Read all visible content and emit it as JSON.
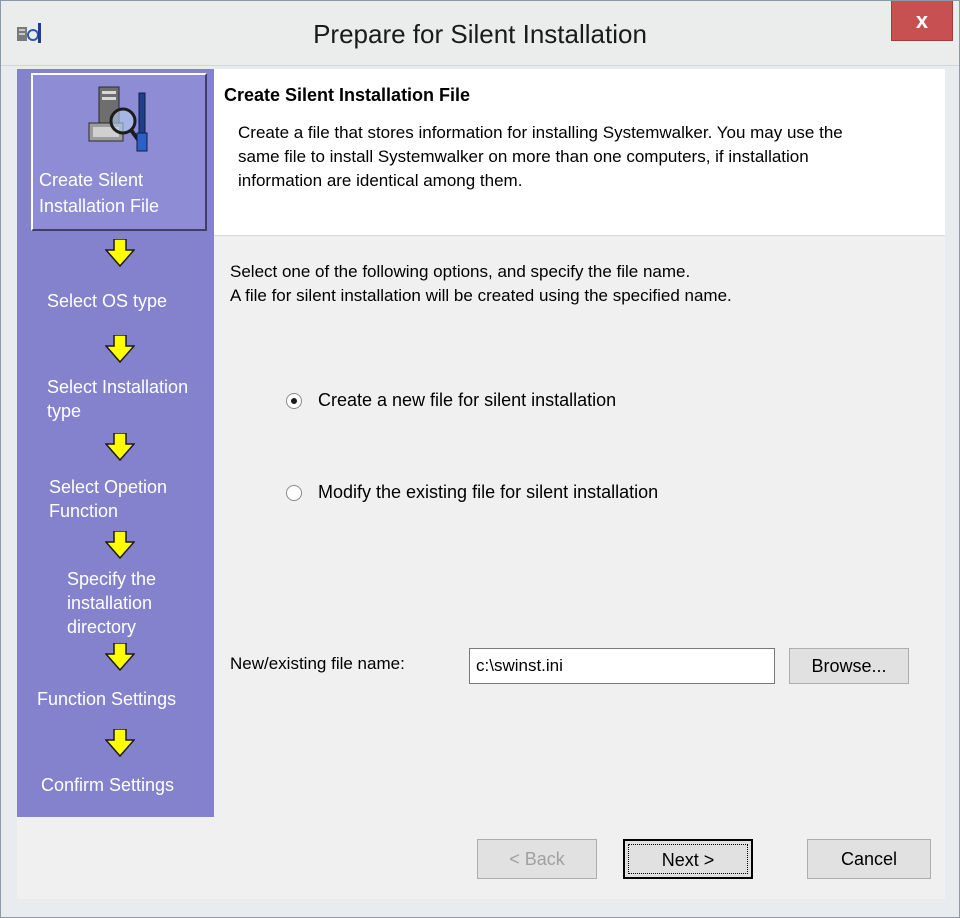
{
  "window": {
    "title": "Prepare for Silent Installation",
    "close_label": "x"
  },
  "sidebar": {
    "steps": [
      {
        "label": "Create Silent Installation File",
        "active": true
      },
      {
        "label": "Select OS type"
      },
      {
        "label": "Select Installation type"
      },
      {
        "label": "Select Opetion Function"
      },
      {
        "label": "Specify the installation directory"
      },
      {
        "label": "Function Settings"
      },
      {
        "label": "Confirm Settings"
      }
    ],
    "arrow_color": "#ffff00"
  },
  "header": {
    "title": "Create Silent Installation File",
    "description": "Create a file that stores information for installing Systemwalker. You may use the same file to install Systemwalker on more than one computers, if installation information are identical among them."
  },
  "main": {
    "instructions_line1": "Select one of the following options, and specify the file name.",
    "instructions_line2": "A file for silent installation will be created using the specified name.",
    "option_new": {
      "label": "Create a new file for silent installation",
      "selected": true
    },
    "option_modify": {
      "label": "Modify the existing file for silent installation",
      "selected": false
    },
    "file_label": "New/existing file name:",
    "file_value": "c:\\swinst.ini",
    "browse_label": "Browse..."
  },
  "footer": {
    "back_label": "< Back",
    "next_label": "Next >",
    "cancel_label": "Cancel"
  },
  "colors": {
    "sidebar": "#8482cc",
    "close_button": "#c75050"
  }
}
